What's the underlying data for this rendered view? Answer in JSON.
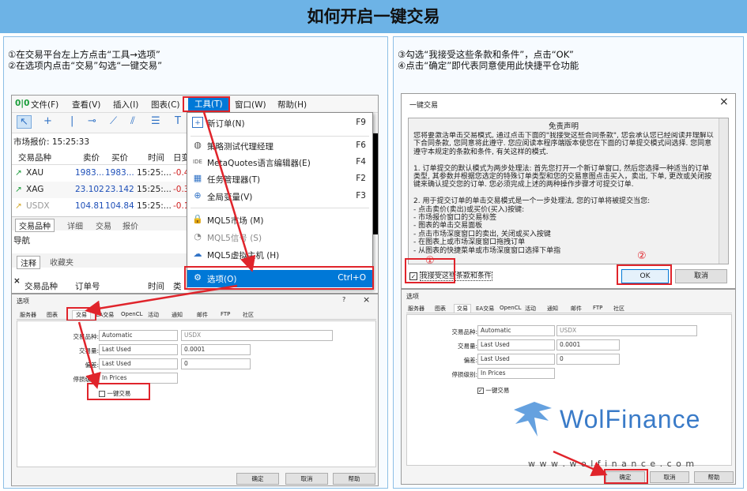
{
  "page": {
    "title": "如何开启一键交易"
  },
  "left_instructions": [
    "①在交易平台左上方点击“工具→选项”",
    "②在选项内点击“交易”勾选“一键交易”"
  ],
  "right_instructions": [
    "③勾选“我接受这些条款和条件”，点击“OK”",
    "④点击“确定”即代表同意使用此快捷平仓功能"
  ],
  "mt_menu": {
    "items": [
      "文件(F)",
      "查看(V)",
      "插入(I)",
      "图表(C)",
      "工具(T)",
      "窗口(W)",
      "帮助(H)"
    ]
  },
  "tools_menu": [
    {
      "icon": "new-order-icon",
      "label": "新订单(N)",
      "shortcut": "F9"
    },
    {
      "icon": "strategy-tester-icon",
      "label": "策略测试代理经理",
      "shortcut": "F6"
    },
    {
      "icon": "metaeditor-icon",
      "label": "MetaQuotes语言编辑器(E)",
      "shortcut": "F4"
    },
    {
      "icon": "task-manager-icon",
      "label": "任务管理器(T)",
      "shortcut": "F2"
    },
    {
      "icon": "global-variables-icon",
      "label": "全局变量(V)",
      "shortcut": "F3"
    },
    {
      "icon": "mql5-market-icon",
      "label": "MQL5市场 (M)",
      "shortcut": ""
    },
    {
      "icon": "mql5-signals-icon",
      "label": "MQL5信号 (S)",
      "shortcut": ""
    },
    {
      "icon": "mql5-vps-icon",
      "label": "MQL5虚拟主机 (H)",
      "shortcut": ""
    },
    {
      "icon": "options-gear-icon",
      "label": "选项(O)",
      "shortcut": "Ctrl+O"
    }
  ],
  "market_watch": {
    "header": "市场报价: 15:25:33",
    "columns": [
      "交易品种",
      "卖价",
      "买价",
      "时间",
      "日变"
    ],
    "rows": [
      {
        "symbol": "XAU",
        "bid": "1983...",
        "ask": "1983...",
        "time": "15:25:...",
        "change": "-0.4"
      },
      {
        "symbol": "XAG",
        "bid": "23.102",
        "ask": "23.142",
        "time": "15:25:...",
        "change": "-0.3"
      },
      {
        "symbol": "USDX",
        "bid": "104.81",
        "ask": "104.84",
        "time": "15:25:...",
        "change": "-0.1"
      }
    ],
    "tabs": [
      "交易品种",
      "详细",
      "交易",
      "报价"
    ]
  },
  "navigator": {
    "title": "导航",
    "tabs": [
      "注释",
      "收藏夹"
    ]
  },
  "toolbox": {
    "columns": [
      "交易品种",
      "订单号",
      "时间",
      "类"
    ]
  },
  "options_dialog": {
    "title": "选项",
    "tabs": [
      "服务器",
      "图表",
      "交易",
      "EA交易",
      "OpenCL",
      "活动",
      "通知",
      "邮件",
      "FTP",
      "社区"
    ],
    "fields": [
      {
        "label": "交易品种:",
        "value": "Automatic",
        "extra": "USDX"
      },
      {
        "label": "交易量:",
        "value": "Last Used",
        "extra": "0.0001"
      },
      {
        "label": "偏差:",
        "value": "Last Used",
        "extra": "0"
      },
      {
        "label": "停损级别:",
        "value": "In Prices",
        "extra": ""
      }
    ],
    "checkbox_label": "一键交易",
    "buttons": [
      "确定",
      "取消",
      "帮助"
    ]
  },
  "oneclick_dialog": {
    "title": "一键交易",
    "heading": "免责声明",
    "text": "您将要激活单击交易模式, 通过点击下面的\"我接受这些合同条款\", 您会承认您已经阅读并理解以下合同条款, 您同意将此遵守. 您应阅读本程序端版本使您在下面的订单提交模式间选择. 您同意遵守本规定的条款和条件, 有关这样的模式.\n\n1. 订单提交的默认模式为两步处理法: 首先您打开一个新订单窗口, 然后您选择一种适当的订单类型, 其参数并根据您选定的特殊订单类型和您的交易意图点击买入，卖出, 下单, 更改或关闭按键来确认提交您的订单. 您必须完成上述的两种操作步骤才可提交订单.\n\n2. 用于提交订单的单击交易模式是一个一步处理法, 您的订单将被提交当您:\n- 点击卖价(卖出)或买价(买入)按键:\n  - 市场报价窗口的交易标签\n  - 图表的单击交易面板\n- 点击市场深度窗口的卖出, 关闭或买入按键\n- 在图表上或市场深度窗口拖拽订单\n- 从图表的快捷菜单或市场深度窗口选择下单指",
    "accept_label": "我接受这些条款和条件",
    "ok": "OK",
    "cancel": "取消"
  },
  "options_dialog_2": {
    "title": "选项",
    "tabs": [
      "服务器",
      "图表",
      "交易",
      "EA交易",
      "OpenCL",
      "活动",
      "通知",
      "邮件",
      "FTP",
      "社区"
    ],
    "fields": [
      {
        "label": "交易品种:",
        "value": "Automatic",
        "extra": "USDX"
      },
      {
        "label": "交易量:",
        "value": "Last Used",
        "extra": "0.0001"
      },
      {
        "label": "偏差:",
        "value": "Last Used",
        "extra": "0"
      },
      {
        "label": "停损级别:",
        "value": "In Prices",
        "extra": ""
      }
    ],
    "checkbox_label": "一键交易",
    "buttons": [
      "确定",
      "取消",
      "帮助"
    ]
  },
  "markers": {
    "one": "①",
    "two": "②"
  },
  "watermark": {
    "brand": "WolFinance",
    "url": "w w w . w o l f i n a n c e . c o m"
  },
  "colors": {
    "title_bg": "#6db3e6",
    "highlight": "#e0242b",
    "selected": "#0078d7",
    "brand": "#3a7bc8"
  }
}
